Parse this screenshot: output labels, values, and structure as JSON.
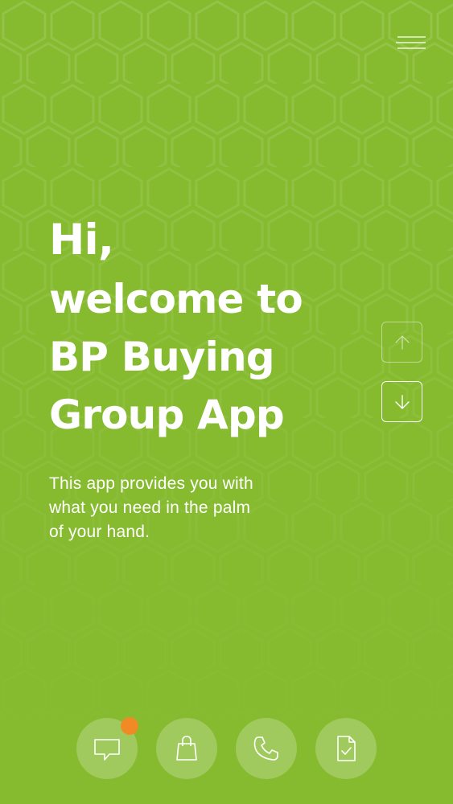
{
  "hero": {
    "greeting": "Hi,",
    "title_lines": [
      "welcome to",
      "BP Buying",
      "Group App"
    ],
    "description_lines": [
      "This app provides you with",
      "what you need in the palm",
      "of your hand."
    ]
  },
  "icons": {
    "menu": "hamburger-menu-icon",
    "scroll_up": "arrow-up-icon",
    "scroll_down": "arrow-down-icon",
    "nav": [
      "chat-icon",
      "shopping-bag-icon",
      "phone-icon",
      "document-check-icon"
    ]
  },
  "colors": {
    "background": "#86bb30",
    "text": "#ffffff",
    "notification_badge": "#f08a24"
  }
}
